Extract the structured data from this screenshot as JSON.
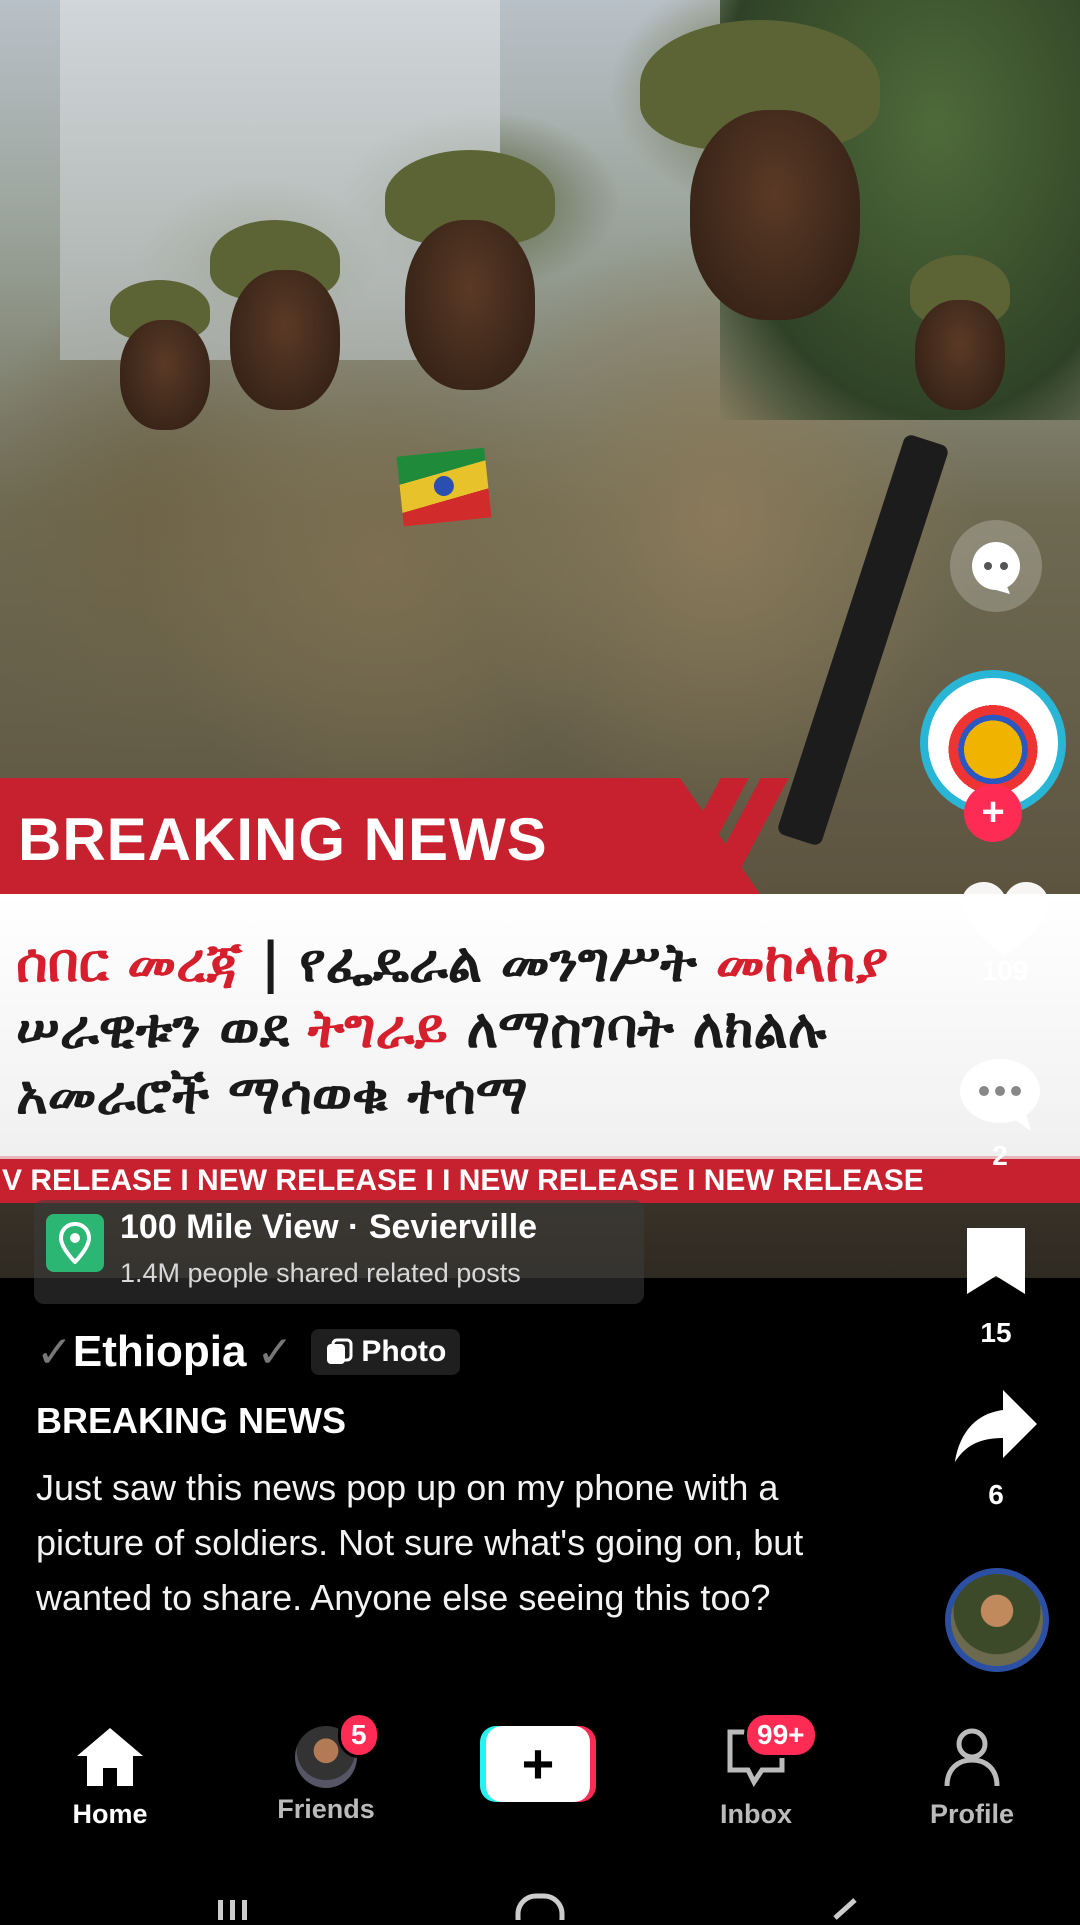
{
  "post_image": {
    "banner_title": "BREAKING NEWS",
    "headline_parts": [
      {
        "text": "ሰበር መረጃ",
        "color": "#d51f2d"
      },
      {
        "text": " | የፌዴራል መንግሥት ",
        "color": "#1a1a1a"
      },
      {
        "text": "መከላከያ",
        "color": "#d51f2d"
      },
      {
        "text": " ሠራዊቱን ወደ ",
        "color": "#1a1a1a"
      },
      {
        "text": "ትግራይ",
        "color": "#d51f2d"
      },
      {
        "text": " ለማስገባት ለክልሉ አመራሮች ማሳወቁ ተሰማ",
        "color": "#1a1a1a"
      }
    ],
    "ticker": "V RELEASE I NEW RELEASE I  I NEW RELEASE I NEW RELEASE"
  },
  "location": {
    "title": "100 Mile View · Sevierville",
    "subtitle": "1.4M people shared related posts",
    "icon": "map-pin-icon"
  },
  "rail": {
    "likes": "109",
    "comments": "2",
    "saves": "15",
    "shares": "6"
  },
  "caption": {
    "username": "Ethiopia",
    "prefix_mark": "✓",
    "suffix_mark": "✓",
    "type_tag": "Photo",
    "title": "BREAKING NEWS",
    "description": "Just saw this news pop up on my phone with a picture of soldiers. Not sure what's going on, but wanted to share. Anyone else seeing this too?"
  },
  "nav": {
    "home": "Home",
    "friends": "Friends",
    "friends_badge": "5",
    "create": "+",
    "inbox": "Inbox",
    "inbox_badge": "99+",
    "profile": "Profile"
  },
  "colors": {
    "accent": "#fe2c55",
    "accent_cyan": "#25f4ee",
    "breaking_red": "#c7212f"
  }
}
